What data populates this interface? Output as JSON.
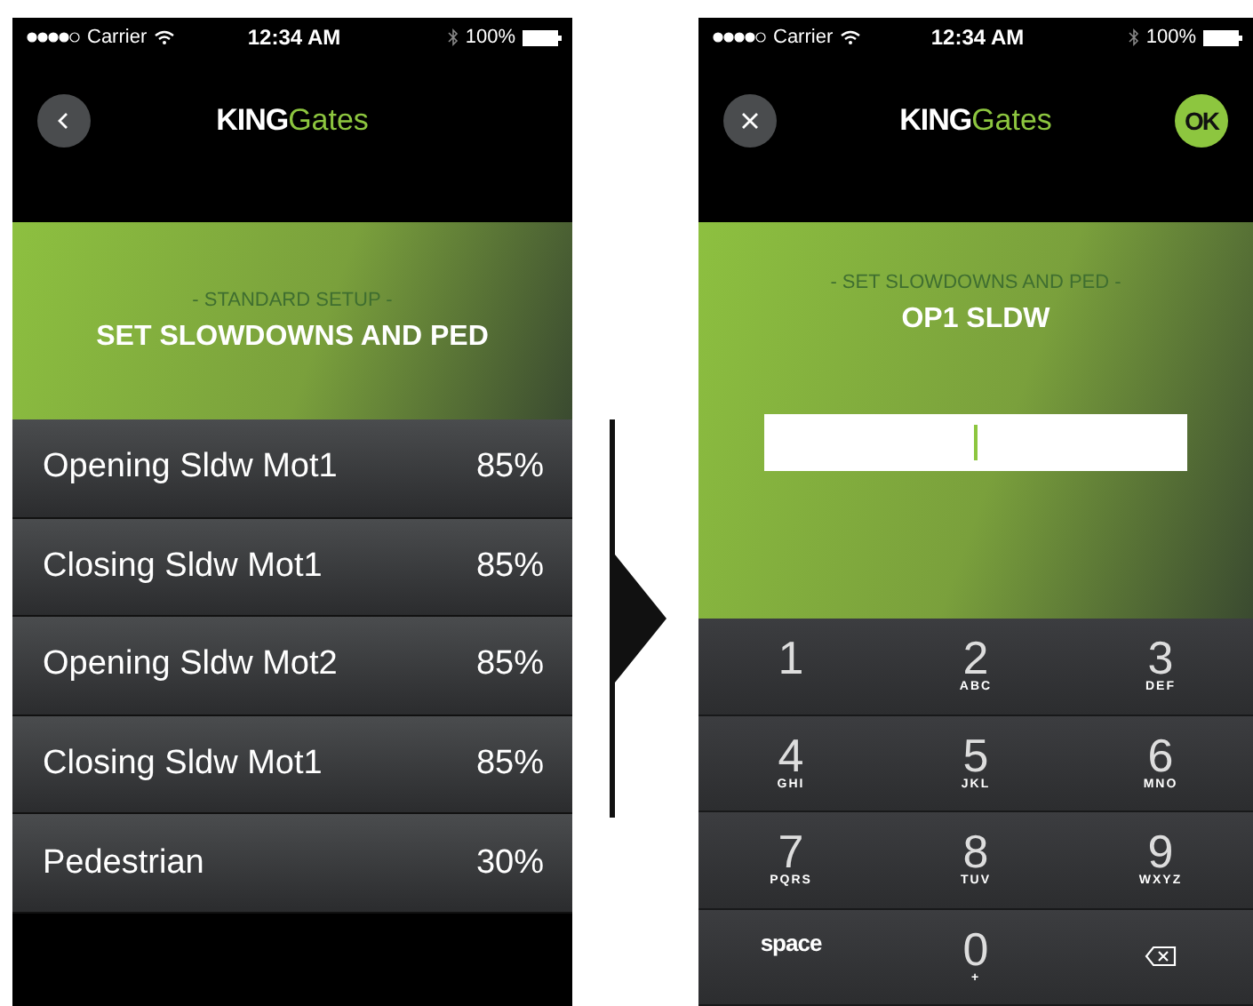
{
  "screens": [
    {
      "kind": "list",
      "status_bar": {
        "carrier": "Carrier",
        "time": "12:34 AM",
        "battery": "100%"
      },
      "header": {
        "left_button": {
          "kind": "back"
        },
        "logo_bold": "KING",
        "logo_light": "Gates"
      },
      "banner": {
        "subtitle": "- STANDARD SETUP -",
        "title": "SET SLOWDOWNS AND PED"
      },
      "rows": [
        {
          "label": "Opening Sldw Mot1",
          "value": "85%"
        },
        {
          "label": "Closing Sldw Mot1",
          "value": "85%"
        },
        {
          "label": "Opening Sldw Mot2",
          "value": "85%"
        },
        {
          "label": "Closing Sldw Mot1",
          "value": "85%"
        },
        {
          "label": "Pedestrian",
          "value": "30%"
        }
      ]
    },
    {
      "kind": "entry",
      "status_bar": {
        "carrier": "Carrier",
        "time": "12:34 AM",
        "battery": "100%"
      },
      "header": {
        "left_button": {
          "kind": "close"
        },
        "logo_bold": "KING",
        "logo_light": "Gates",
        "ok_button": "OK"
      },
      "banner": {
        "subtitle": "- SET SLOWDOWNS AND PED -",
        "title": "OP1 SLDW"
      },
      "keys": [
        {
          "kind": "digit",
          "digit": "1"
        },
        {
          "kind": "digit",
          "digit": "2",
          "letters": "ABC"
        },
        {
          "kind": "digit",
          "digit": "3",
          "letters": "DEF"
        },
        {
          "kind": "digit",
          "digit": "4",
          "letters": "GHI"
        },
        {
          "kind": "digit",
          "digit": "5",
          "letters": "JKL"
        },
        {
          "kind": "digit",
          "digit": "6",
          "letters": "MNO"
        },
        {
          "kind": "digit",
          "digit": "7",
          "letters": "PQRS"
        },
        {
          "kind": "digit",
          "digit": "8",
          "letters": "TUV"
        },
        {
          "kind": "digit",
          "digit": "9",
          "letters": "WXYZ"
        },
        {
          "kind": "space",
          "label": "space"
        },
        {
          "kind": "digit",
          "digit": "0",
          "letters": "+"
        },
        {
          "kind": "delete"
        }
      ]
    }
  ]
}
